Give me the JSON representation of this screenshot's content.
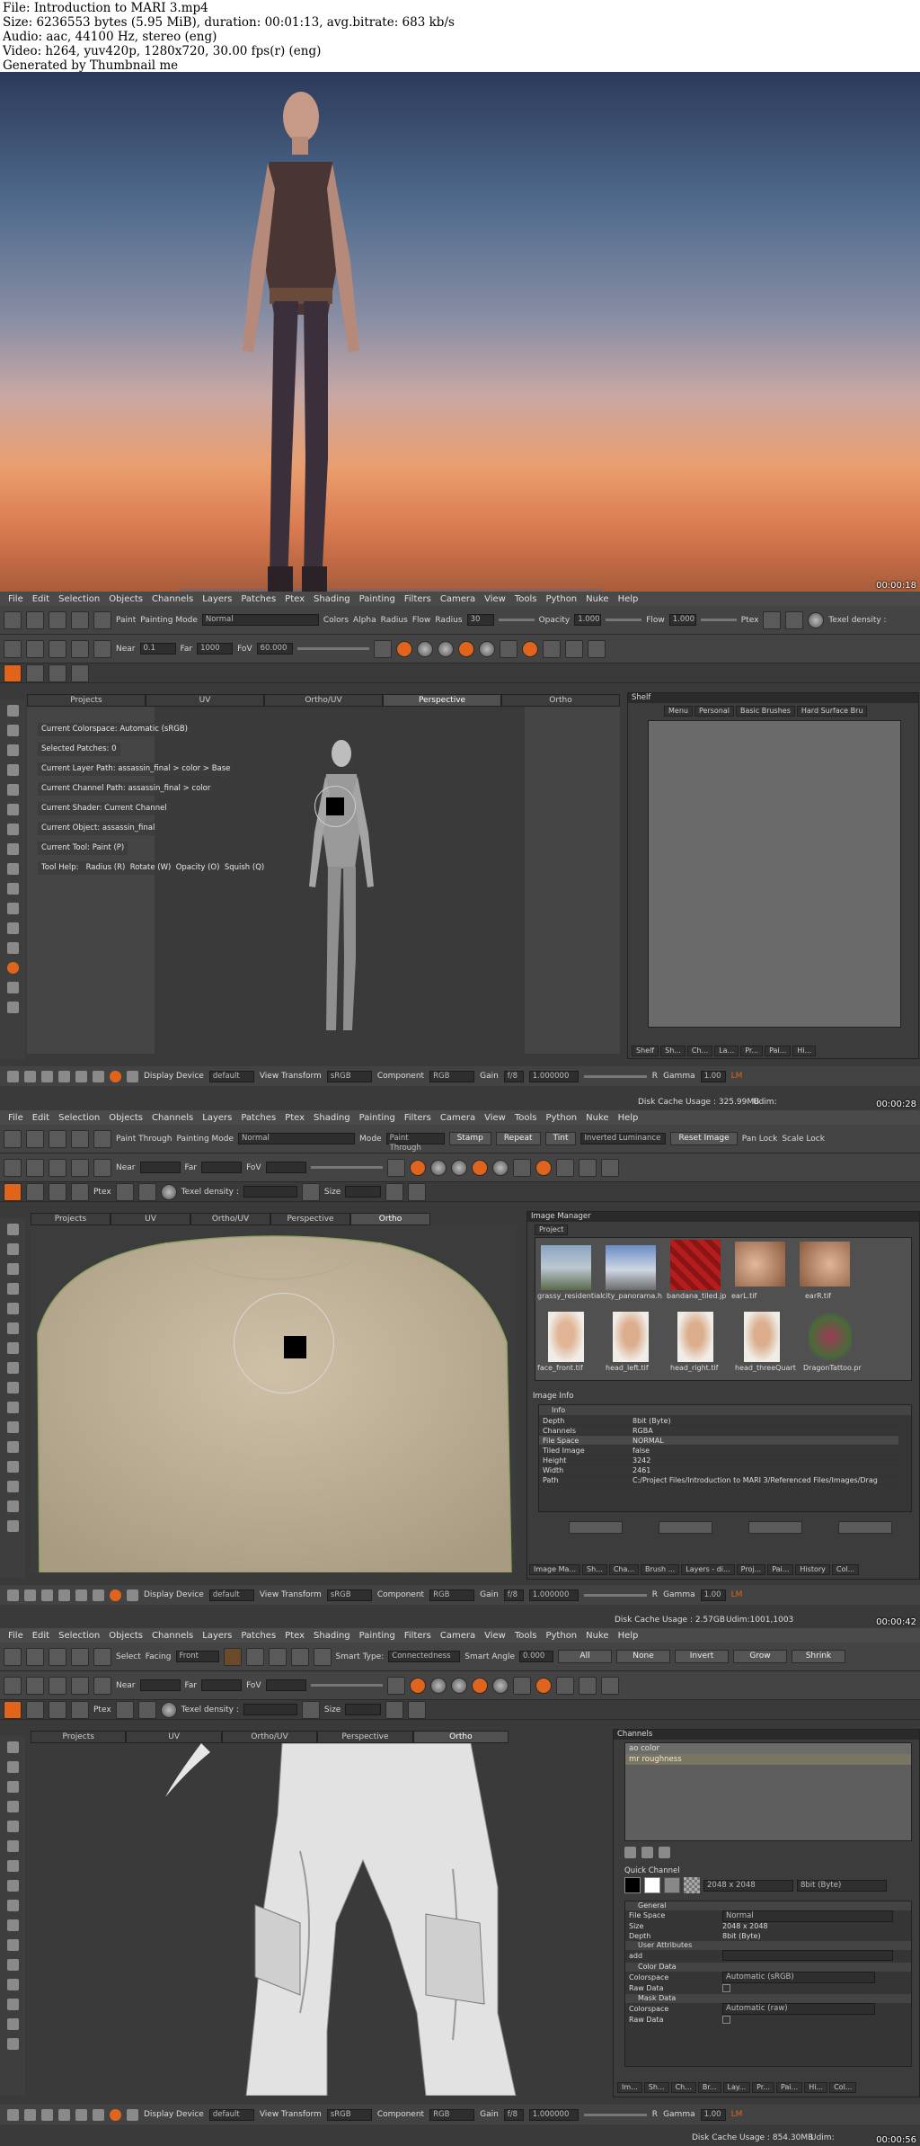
{
  "header": {
    "file": "File: Introduction to MARI 3.mp4",
    "size": "Size: 6236553 bytes (5.95 MiB), duration: 00:01:13, avg.bitrate: 683 kb/s",
    "audio": "Audio: aac, 44100 Hz, stereo (eng)",
    "video": "Video: h264, yuv420p, 1280x720, 30.00 fps(r) (eng)",
    "generator": "Generated by Thumbnail me"
  },
  "frames": {
    "f1": {
      "time": "00:00:18"
    },
    "f2": {
      "time": "00:00:28",
      "disk": "Disk Cache Usage : 325.99MB",
      "udim": "Udim:"
    },
    "f3": {
      "time": "00:00:42",
      "disk": "Disk Cache Usage : 2.57GB",
      "udim": "Udim:1001,1003"
    },
    "f4": {
      "time": "00:00:56",
      "disk": "Disk Cache Usage : 854.30MB",
      "udim": "Udim:"
    }
  },
  "menu": [
    "File",
    "Edit",
    "Selection",
    "Objects",
    "Channels",
    "Layers",
    "Patches",
    "Ptex",
    "Shading",
    "Painting",
    "Filters",
    "Camera",
    "View",
    "Tools",
    "Python",
    "Nuke",
    "Help"
  ],
  "toolbar2": {
    "paint": "Paint",
    "painting_mode": "Painting Mode",
    "mode_val": "Normal",
    "colors": "Colors",
    "alpha": "Alpha",
    "radius": "Radius",
    "flow": "Flow",
    "radius2": "Radius",
    "radius_val": "30",
    "opacity": "Opacity",
    "opacity_val": "1.000",
    "flow2": "Flow",
    "flow_val": "1.000",
    "ptex": "Ptex",
    "texel": "Texel density :"
  },
  "toolbar2b": {
    "near": "Near",
    "near_val": "0.1",
    "far": "Far",
    "far_val": "1000",
    "fov": "FoV",
    "fov_val": "60.000"
  },
  "viewtabs": [
    "Projects",
    "UV",
    "Ortho/UV",
    "Perspective",
    "Ortho"
  ],
  "hud": [
    "Current Colorspace: Automatic (sRGB)",
    "Selected Patches: 0",
    "Current Layer Path: assassin_final > color > Base",
    "Current Channel Path: assassin_final > color",
    "Current Shader: Current Channel",
    "Current Object: assassin_final",
    "Current Tool: Paint (P)"
  ],
  "toolhelp": {
    "label": "Tool Help:",
    "radius": "Radius (R)",
    "rotate": "Rotate (W)",
    "opacity": "Opacity (O)",
    "squish": "Squish (Q)"
  },
  "shelf": {
    "title": "Shelf",
    "tabs": [
      "Menu",
      "Personal",
      "Basic Brushes",
      "Hard Surface Bru"
    ],
    "bottom": [
      "Shelf",
      "Sh...",
      "Ch...",
      "La...",
      "Pr...",
      "Pai...",
      "Hi..."
    ]
  },
  "status": {
    "display_device": "Display Device",
    "dd_val": "default",
    "view_transform": "View Transform",
    "vt_val": "sRGB",
    "component": "Component",
    "comp_val": "RGB",
    "gain": "Gain",
    "gain_val": "f/8",
    "g_num": "1.000000",
    "r": "R",
    "gamma": "Gamma",
    "gamma_val": "1.00",
    "lm": "LM"
  },
  "toolbar3": {
    "paint_through": "Paint Through",
    "painting_mode": "Painting Mode",
    "mode_val": "Normal",
    "mode": "Mode",
    "mode2_val": "Paint Through",
    "stamp": "Stamp",
    "repeat": "Repeat",
    "tint": "Tint",
    "inverted": "Inverted Luminance",
    "reset": "Reset Image",
    "pan_lock": "Pan Lock",
    "scale_lock": "Scale Lock",
    "ptex": "Ptex",
    "texel": "Texel density :",
    "size": "Size"
  },
  "toolbar3b": {
    "near": "Near",
    "far": "Far",
    "fov": "FoV"
  },
  "image_manager": {
    "title": "Image Manager",
    "project": "Project",
    "images": [
      "grassy_residential",
      "city_panorama.h",
      "bandana_tiled.jp",
      "earL.tif",
      "earR.tif",
      "face_front.tif",
      "head_left.tif",
      "head_right.tif",
      "head_threeQuart",
      "DragonTattoo.pr"
    ],
    "info_title": "Image Info",
    "info_head": "Info",
    "rows": [
      [
        "Depth",
        "8bit (Byte)"
      ],
      [
        "Channels",
        "RGBA"
      ],
      [
        "File Space",
        "NORMAL"
      ],
      [
        "Tiled Image",
        "false"
      ],
      [
        "Height",
        "3242"
      ],
      [
        "Width",
        "2461"
      ],
      [
        "Path",
        "C:/Project Files/Introduction to MARI 3/Referenced Files/Images/Drag"
      ]
    ],
    "bottom": [
      "Image Ma...",
      "Sh...",
      "Cha...",
      "Brush ...",
      "Layers - di...",
      "Proj...",
      "Pai...",
      "History",
      "Col..."
    ]
  },
  "toolbar4": {
    "select": "Select",
    "facing": "Facing",
    "facing_val": "Front",
    "smart": "Smart Type:",
    "smart_val": "Connectedness",
    "angle": "Smart Angle",
    "angle_val": "0.000",
    "all": "All",
    "none": "None",
    "invert": "Invert",
    "grow": "Grow",
    "shrink": "Shrink"
  },
  "channels": {
    "title": "Channels",
    "items": [
      "ao color",
      "mr roughness"
    ],
    "quick": "Quick Channel",
    "res": "2048 x 2048",
    "depth": "8bit (Byte)",
    "general": "General",
    "file_space": "File Space",
    "fs_val": "Normal",
    "size": "Size",
    "size_val": "2048 x 2048",
    "depth_l": "Depth",
    "depth_val": "8bit (Byte)",
    "user": "User Attributes",
    "add": "add",
    "color_data": "Color Data",
    "colorspace": "Colorspace",
    "cs_val": "Automatic (sRGB)",
    "raw": "Raw Data",
    "mask_data": "Mask Data",
    "colorspace2": "Colorspace",
    "cs2_val": "Automatic (raw)",
    "raw2": "Raw Data",
    "bottom": [
      "Im...",
      "Sh...",
      "Ch...",
      "Br...",
      "Lay...",
      "Pr...",
      "Pai...",
      "Hi...",
      "Col..."
    ]
  }
}
